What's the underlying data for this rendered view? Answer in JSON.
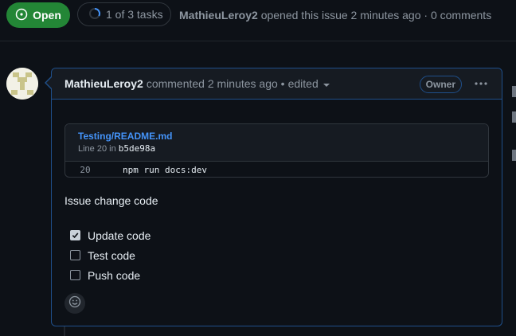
{
  "header": {
    "state_label": "Open",
    "tasks_label": "1 of 3 tasks",
    "author": "MathieuLeroy2",
    "meta_text": "opened this issue 2 minutes ago · 0 comments"
  },
  "comment": {
    "author": "MathieuLeroy2",
    "action": "commented 2 minutes ago •",
    "edited_label": "edited",
    "owner_badge": "Owner",
    "permalink": {
      "file": "Testing/README.md",
      "line_prefix": "Line 20 in",
      "sha": "b5de98a",
      "line_number": "20",
      "code": "npm run docs:dev"
    },
    "body_text": "Issue change code",
    "tasks": [
      {
        "label": "Update code",
        "checked": true
      },
      {
        "label": "Test code",
        "checked": false
      },
      {
        "label": "Push code",
        "checked": false
      }
    ]
  },
  "icons": {
    "state": "issue-opened-icon",
    "tasks": "progress-circle-icon",
    "edited_caret": "triangle-down-icon",
    "menu": "kebab-horizontal-icon",
    "reaction": "smiley-icon"
  },
  "colors": {
    "background": "#0d1117",
    "open_green": "#238636",
    "link_blue": "#4493f8",
    "comment_border": "#1f4f8a",
    "muted_text": "#8d96a0"
  }
}
